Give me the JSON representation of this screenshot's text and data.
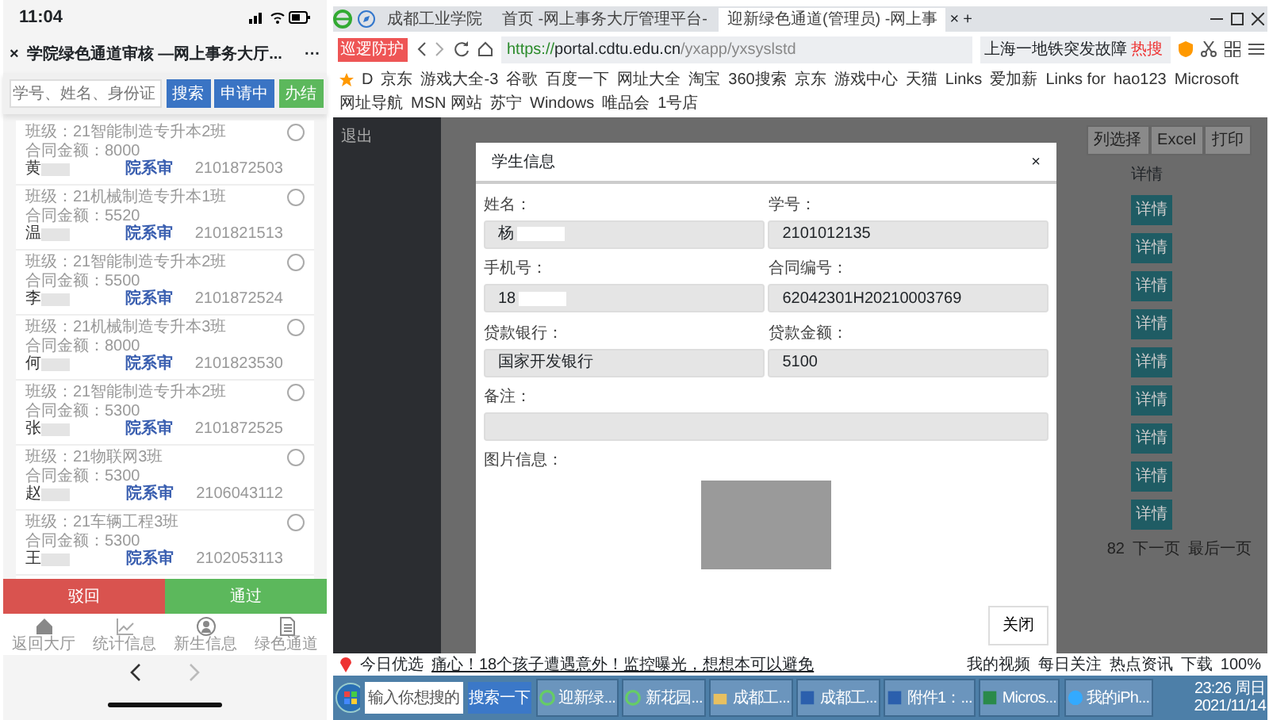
{
  "phone": {
    "time": "11:04",
    "close": "×",
    "title": "学院绿色通道审核 —网上事务大厅...",
    "more": "···",
    "search": {
      "placeholder": "学号、姓名、身份证"
    },
    "buttons": [
      {
        "label": "搜索",
        "kind": "primary"
      },
      {
        "label": "申请中",
        "kind": "primary"
      },
      {
        "label": "办结",
        "kind": "success"
      }
    ],
    "records": [
      {
        "class_line": "班级：21智能制造专升本2班",
        "amount_line": "合同金额：8000",
        "name": "黄",
        "status": "院系审",
        "student_id": "2101872503",
        "selected": false
      },
      {
        "class_line": "班级：21机械制造专升本1班",
        "amount_line": "合同金额：5520",
        "name": "温",
        "status": "院系审",
        "student_id": "2101821513",
        "selected": false
      },
      {
        "class_line": "班级：21智能制造专升本2班",
        "amount_line": "合同金额：5500",
        "name": "李",
        "status": "院系审",
        "student_id": "2101872524",
        "selected": false
      },
      {
        "class_line": "班级：21机械制造专升本3班",
        "amount_line": "合同金额：8000",
        "name": "何",
        "status": "院系审",
        "student_id": "2101823530",
        "selected": false
      },
      {
        "class_line": "班级：21智能制造专升本2班",
        "amount_line": "合同金额：5300",
        "name": "张",
        "status": "院系审",
        "student_id": "2101872525",
        "selected": false
      },
      {
        "class_line": "班级：21物联网3班",
        "amount_line": "合同金额：5300",
        "name": "赵",
        "status": "院系审",
        "student_id": "2106043112",
        "selected": false
      },
      {
        "class_line": "班级：21车辆工程3班",
        "amount_line": "合同金额：5300",
        "name": "王",
        "status": "院系审",
        "student_id": "2102053113",
        "selected": false
      }
    ],
    "actions": [
      {
        "label": "驳回",
        "kind": "danger"
      },
      {
        "label": "通过",
        "kind": "success"
      }
    ],
    "tabbar": [
      {
        "label": "返回大厅",
        "kind": "home"
      },
      {
        "label": "统计信息",
        "kind": "chart"
      },
      {
        "label": "新生信息",
        "kind": "person"
      },
      {
        "label": "绿色通道",
        "kind": "document"
      }
    ]
  },
  "browser": {
    "tabs": [
      {
        "label": "成都工业学院",
        "selected": false
      },
      {
        "label": "首页 -网上事务大厅管理平台-",
        "selected": false
      },
      {
        "label": "迎新绿色通道(管理员) -网上事",
        "selected": true
      }
    ],
    "tab_close": "×",
    "new_tab": "+",
    "badge": "巡逻防护",
    "url_scheme": "https://",
    "url_host": "portal.cdtu.edu.cn",
    "url_path": "/yxapp/yxsyslstd",
    "search_hint": "上海一地铁突发故障",
    "hot": "热搜",
    "bookmarks": [
      "D",
      "京东",
      "游戏大全-3",
      "谷歌",
      "百度一下",
      "网址大全",
      "淘宝",
      "360搜索",
      "京东",
      "游戏中心",
      "天猫",
      "Links",
      "爱加薪",
      "Links for",
      "hao123",
      "Microsoft",
      "网址导航",
      "MSN 网站",
      "苏宁",
      "Windows",
      "唯品会",
      "1号店"
    ],
    "page": {
      "logout": "退出",
      "toolbar": [
        "列选择",
        "Excel",
        "打印"
      ],
      "column_header": "详情",
      "detail_buttons": [
        "详情",
        "详情",
        "详情",
        "详情",
        "详情",
        "详情",
        "详情",
        "详情",
        "详情"
      ],
      "pagination": [
        "82",
        "下一页",
        "最后一页"
      ]
    },
    "modal": {
      "title": "学生信息",
      "close": "×",
      "fields": [
        {
          "label": "姓名：",
          "value": "杨",
          "redacted": true,
          "wide": false
        },
        {
          "label": "学号：",
          "value": "2101012135",
          "redacted": false,
          "wide": false
        },
        {
          "label": "手机号：",
          "value": "18",
          "redacted": true,
          "wide": false
        },
        {
          "label": "合同编号：",
          "value": "62042301H20210003769",
          "redacted": false,
          "wide": false
        },
        {
          "label": "贷款银行：",
          "value": "国家开发银行",
          "redacted": false,
          "wide": false
        },
        {
          "label": "贷款金额：",
          "value": "5100",
          "redacted": false,
          "wide": false
        },
        {
          "label": "备注：",
          "redacted": false,
          "wide": true
        }
      ],
      "image_label": "图片信息：",
      "close_button": "关闭"
    },
    "status_bar": {
      "left": "今日优选",
      "news": "痛心！18个孩子遭遇意外！监控曝光，想想本可以避免",
      "right": [
        "我的视频",
        "每日关注",
        "热点资讯",
        "下载"
      ],
      "zoom": "100%"
    },
    "taskbar": {
      "search_placeholder": "输入你想搜的",
      "search_button": "搜索一下",
      "items": [
        {
          "label": "迎新绿...",
          "kind": "ie"
        },
        {
          "label": "新花园...",
          "kind": "ie"
        },
        {
          "label": "成都工...",
          "kind": "folder"
        },
        {
          "label": "成都工...",
          "kind": "word"
        },
        {
          "label": "附件1：...",
          "kind": "word"
        },
        {
          "label": "Micros...",
          "kind": "excel"
        },
        {
          "label": "我的iPh...",
          "kind": "phone"
        }
      ],
      "time": "23:26 周日",
      "date": "2021/11/14"
    }
  }
}
